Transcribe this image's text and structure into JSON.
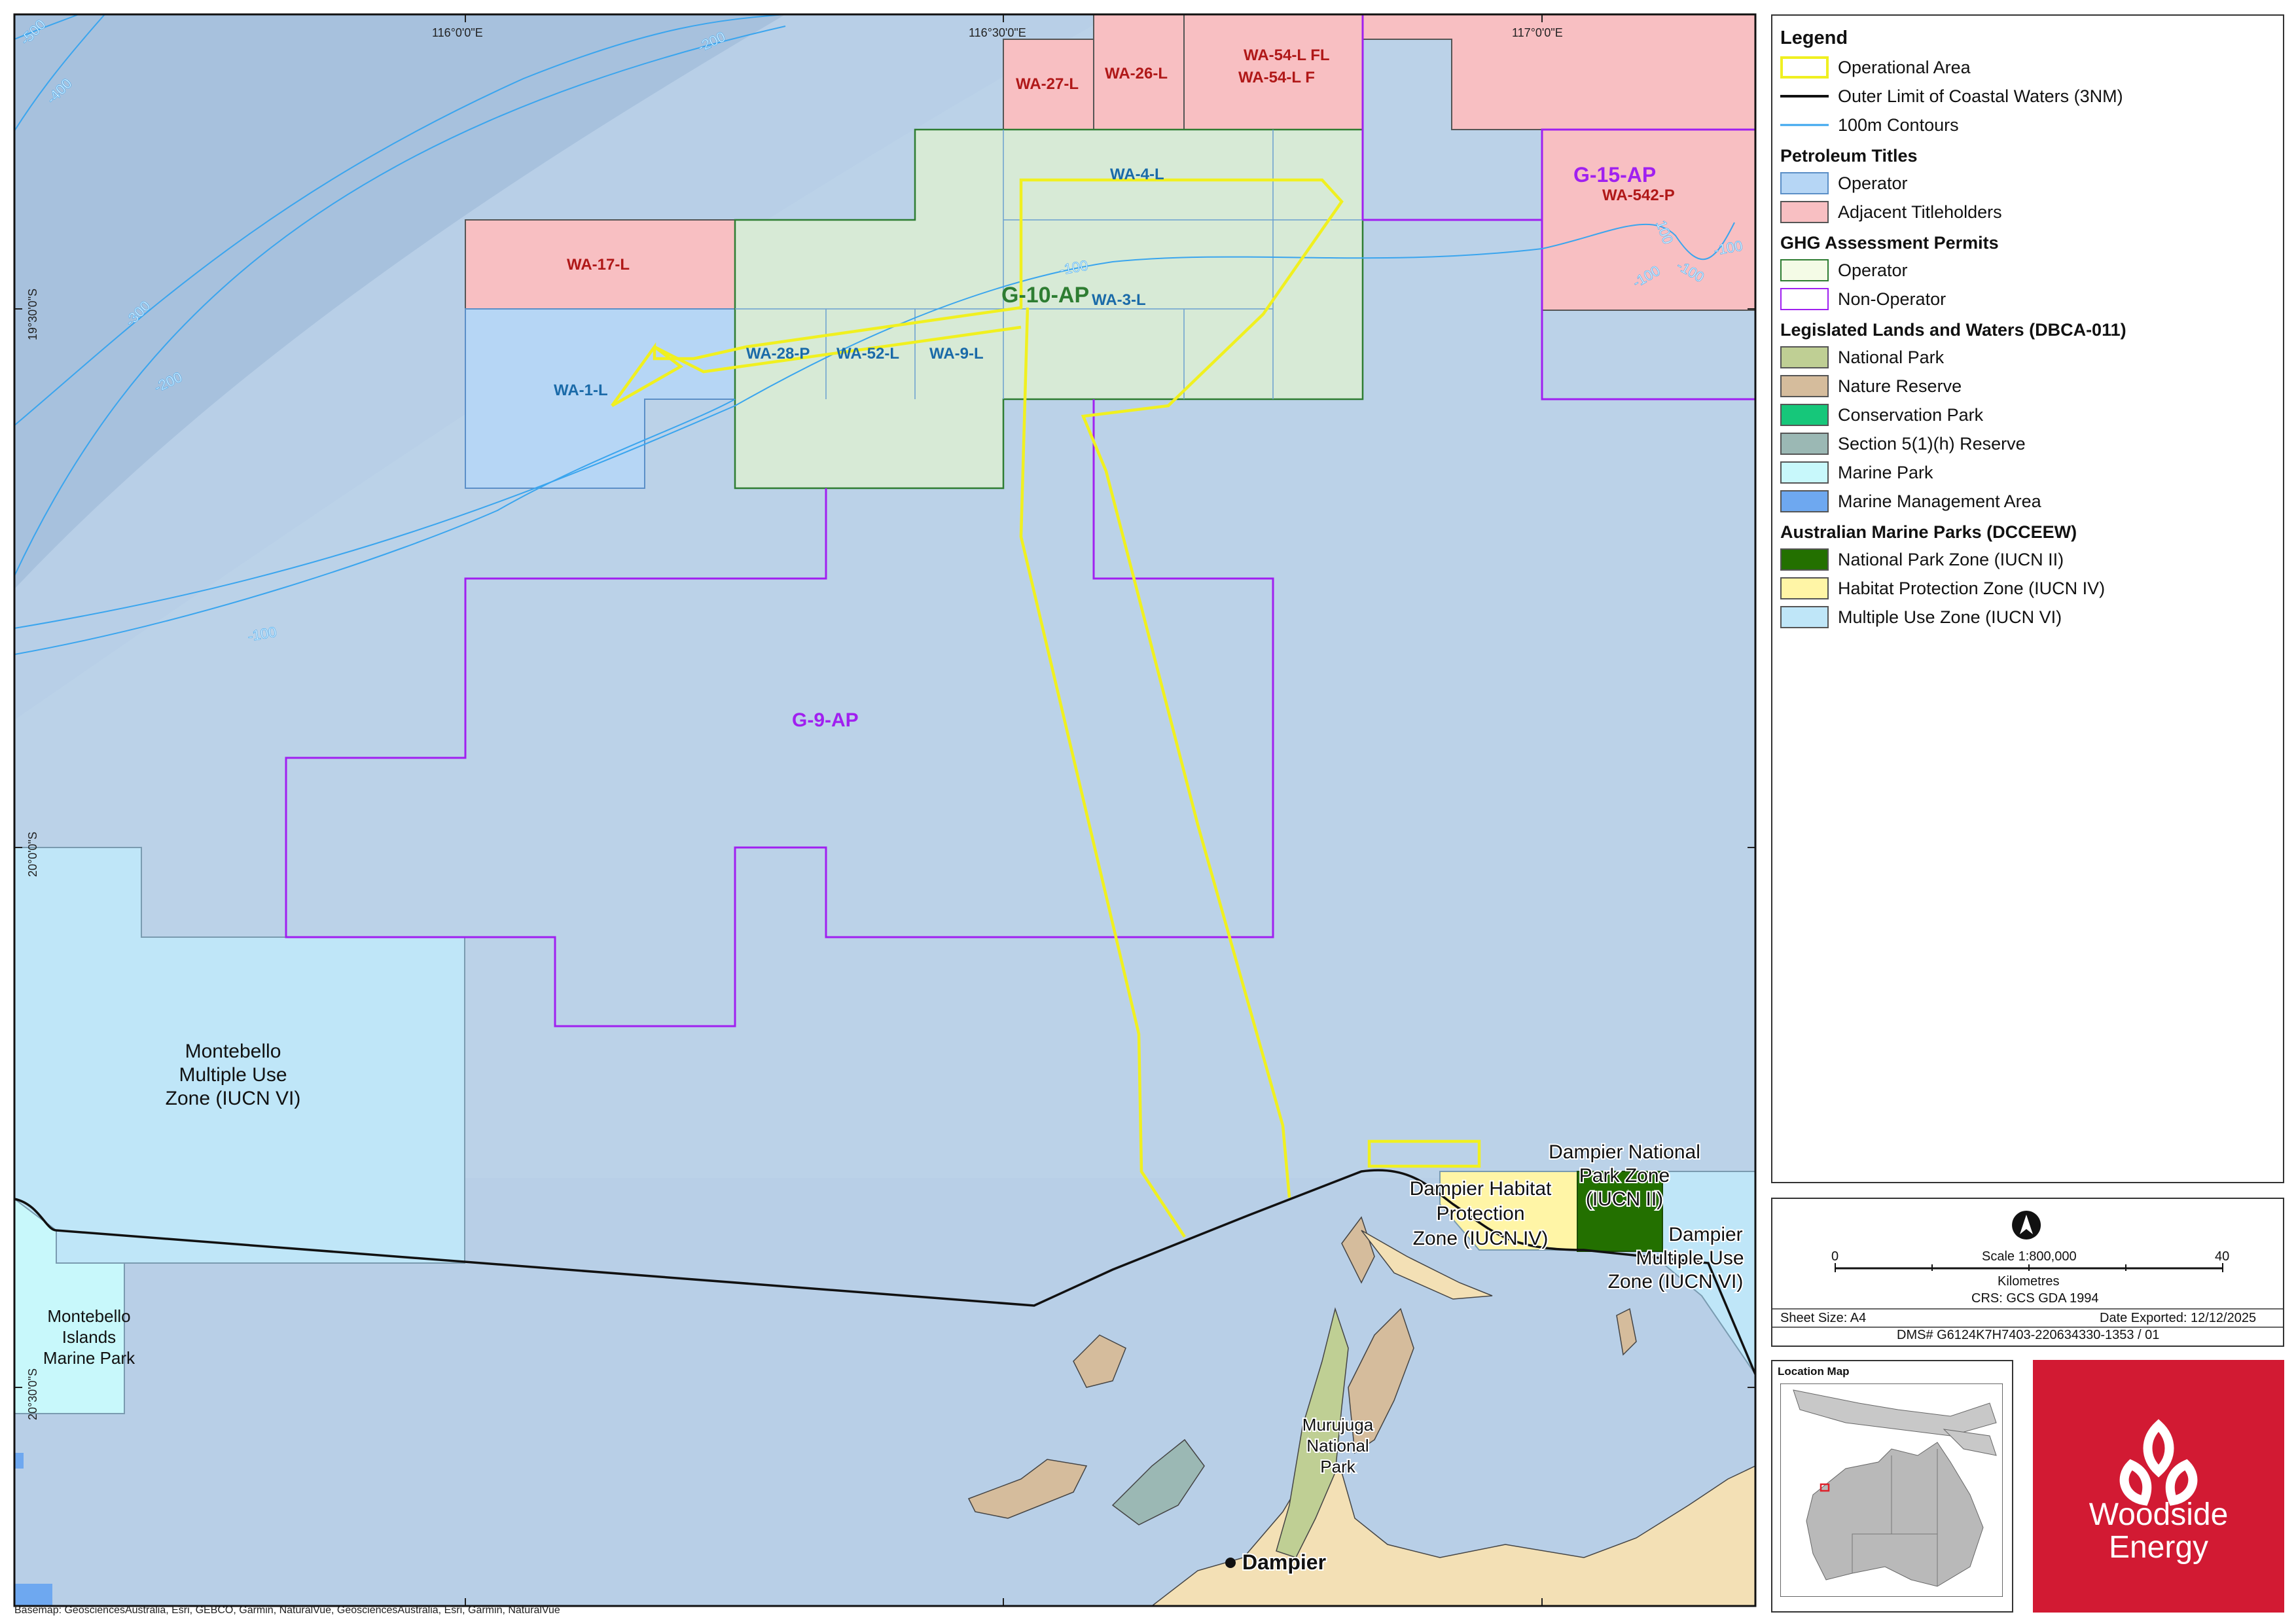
{
  "map": {
    "coordinate_labels": {
      "lon_116_0": "116°0'0\"E",
      "lon_116_30": "116°30'0\"E",
      "lon_117_0": "117°0'0\"E",
      "lat_19_30": "19°30'0\"S",
      "lat_20_0": "20°0'0\"S",
      "lat_20_30": "20°30'0\"S"
    },
    "contour_labels": [
      "-500",
      "-400",
      "-200",
      "-300",
      "-200",
      "-100",
      "-100",
      "-100",
      "100",
      "-100",
      "-100"
    ],
    "title_labels": {
      "wa27": "WA-27-L",
      "wa26": "WA-26-L",
      "wa54a": "WA-54-L FL",
      "wa54b": "WA-54-L F",
      "wa17": "WA-17-L",
      "wa542": "WA-542-P",
      "wa4": "WA-4-L",
      "wa3": "WA-3-L",
      "wa28": "WA-28-P",
      "wa52": "WA-52-L",
      "wa9": "WA-9-L",
      "wa1": "WA-1-L"
    },
    "permit_labels": {
      "g10": "G-10-AP",
      "g15": "G-15-AP",
      "g9": "G-9-AP"
    },
    "place_labels": {
      "montebello_mu": [
        "Montebello",
        "Multiple Use",
        "Zone (IUCN VI)"
      ],
      "montebello_islands": [
        "Montebello",
        "Islands",
        "Marine Park"
      ],
      "dampier_habitat": [
        "Dampier Habitat",
        "Protection",
        "Zone (IUCN IV)"
      ],
      "dampier_np": [
        "Dampier National",
        "Park Zone",
        "(IUCN II)"
      ],
      "dampier_mu": [
        "Dampier",
        "Multiple Use",
        "Zone (IUCN VI)"
      ],
      "murujuga": [
        "Murujuga",
        "National",
        "Park"
      ],
      "dampier_town": "Dampier"
    },
    "colors": {
      "sea": "#bcd3ea",
      "deep_sea": "#a9c4df",
      "operator_title": "#b6d6f5",
      "adjacent_titleholder": "#f8bfc2",
      "ghg_operator": "#e4f4d8",
      "ghg_operator_border": "#2e7d32",
      "non_operator": "#a020f0",
      "operational_area": "#f0f020",
      "contour": "#3aa5ee",
      "multiple_use": "#bfe6f8",
      "habitat_protection": "#fff5a6",
      "national_park_zone": "#237000",
      "land": "#f3e0b5",
      "nature_reserve": "#d5bc9c",
      "section5": "#9bb8b4",
      "national_park": "#bfcf94",
      "marine_park": "#c8f8fb",
      "title_label": "#b01818",
      "operator_label": "#1a6aa8"
    }
  },
  "legend": {
    "title": "Legend",
    "general": [
      {
        "label": "Operational Area",
        "style": "box-yellow"
      },
      {
        "label": "Outer Limit of Coastal Waters (3NM)",
        "style": "line-black"
      },
      {
        "label": "100m Contours",
        "style": "line-blue"
      }
    ],
    "petroleum_title": "Petroleum Titles",
    "petroleum": [
      {
        "label": "Operator",
        "fill": "#b6d6f5",
        "stroke": "#5b8fc7"
      },
      {
        "label": "Adjacent Titleholders",
        "fill": "#f8bfc2",
        "stroke": "#555555"
      }
    ],
    "ghg_title": "GHG Assessment Permits",
    "ghg": [
      {
        "label": "Operator",
        "fill": "#f4fbe6",
        "stroke": "#2e7d32"
      },
      {
        "label": "Non-Operator",
        "fill": "#ffffff",
        "stroke": "#a020f0"
      }
    ],
    "lands_title": "Legislated Lands and Waters (DBCA-011)",
    "lands": [
      {
        "label": "National Park",
        "fill": "#bfcf94"
      },
      {
        "label": "Nature Reserve",
        "fill": "#d5bc9c"
      },
      {
        "label": "Conservation Park",
        "fill": "#16c77a"
      },
      {
        "label": "Section 5(1)(h) Reserve",
        "fill": "#9bb8b4"
      },
      {
        "label": "Marine Park",
        "fill": "#c8f8fb"
      },
      {
        "label": "Marine Management Area",
        "fill": "#6ea8f0"
      }
    ],
    "amp_title": "Australian Marine Parks (DCCEEW)",
    "amp": [
      {
        "label": "National Park Zone (IUCN II)",
        "fill": "#237000"
      },
      {
        "label": "Habitat Protection Zone (IUCN IV)",
        "fill": "#fff5a6"
      },
      {
        "label": "Multiple Use Zone (IUCN VI)",
        "fill": "#bfe6f8"
      }
    ]
  },
  "scale": {
    "zero": "0",
    "scale_text": "Scale 1:800,000",
    "forty": "40",
    "units": "Kilometres",
    "crs": "CRS: GCS GDA 1994",
    "sheet_size": "Sheet Size: A4",
    "date_exported": "Date Exported: 12/12/2025",
    "dms": "DMS# G6124K7H7403-220634330-1353 / 01"
  },
  "location_map": {
    "title": "Location Map"
  },
  "logo": {
    "line1": "Woodside",
    "line2": "Energy"
  },
  "basemap_credit": "Basemap: GeosciencesAustralia, Esri, GEBCO, Garmin, NaturalVue, GeosciencesAustralia, Esri, Garmin, NaturalVue"
}
